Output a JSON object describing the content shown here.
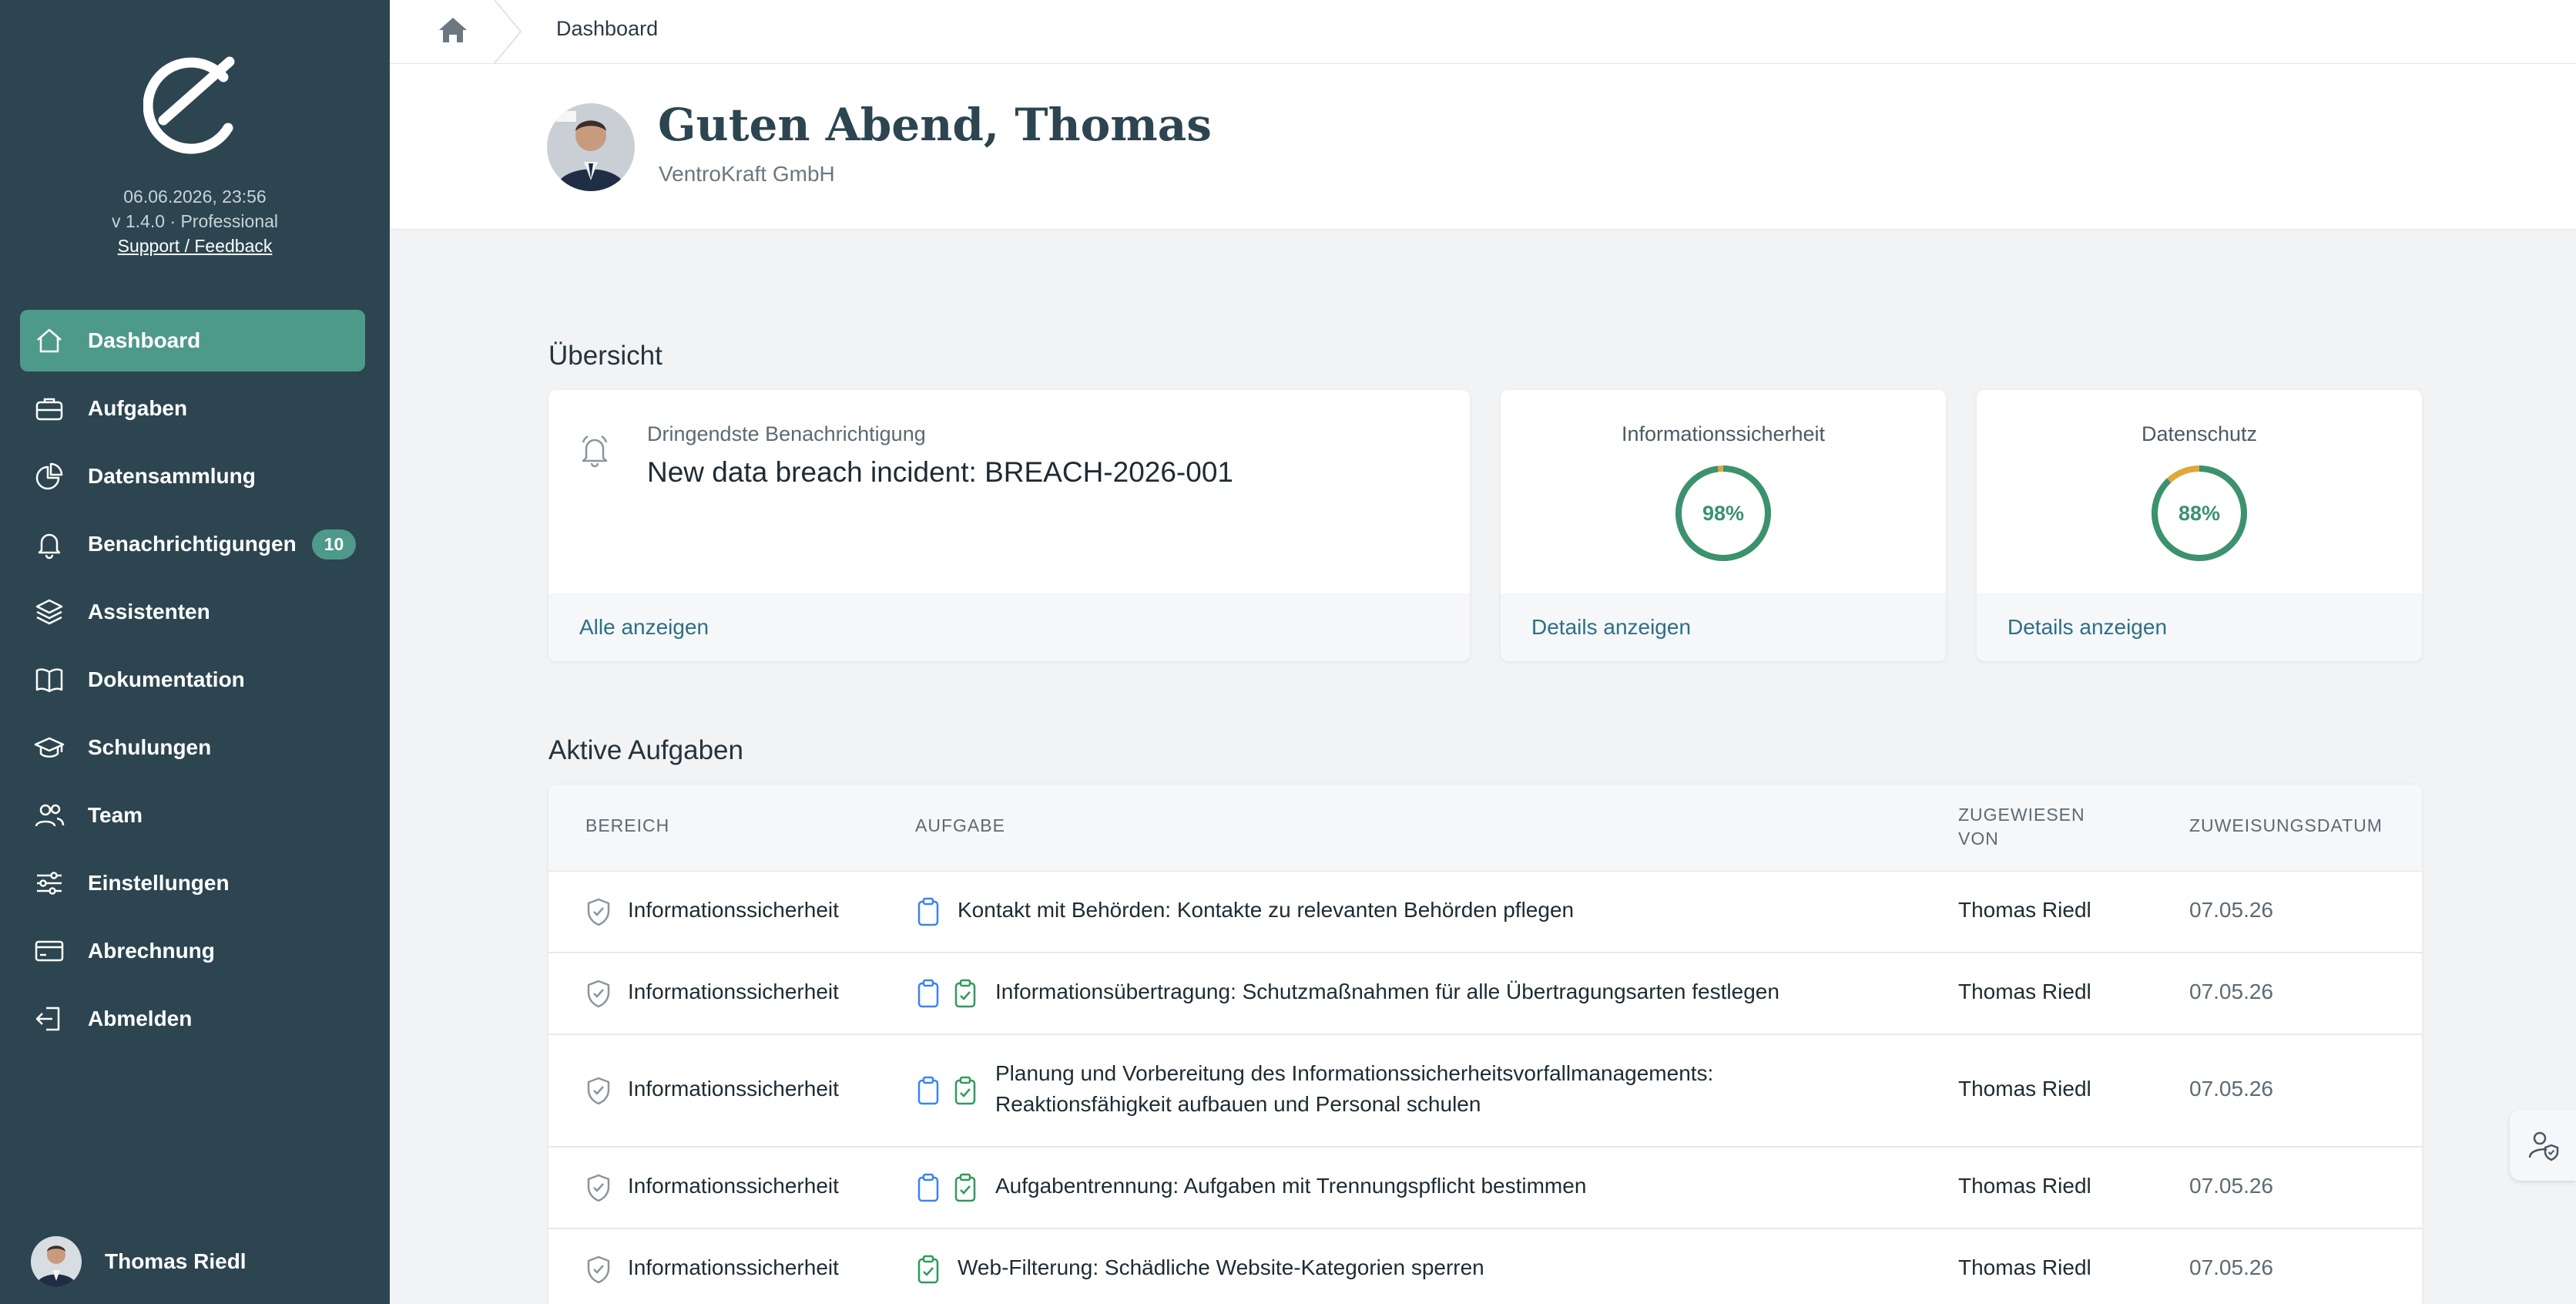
{
  "sidebar": {
    "datetime": "06.06.2026, 23:56",
    "version": "v 1.4.0 · Professional",
    "support_link": "Support / Feedback",
    "nav": [
      {
        "label": "Dashboard",
        "icon": "home-icon",
        "active": true
      },
      {
        "label": "Aufgaben",
        "icon": "briefcase-icon"
      },
      {
        "label": "Datensammlung",
        "icon": "pie-chart-icon"
      },
      {
        "label": "Benachrichtigungen",
        "icon": "bell-icon",
        "badge": "10"
      },
      {
        "label": "Assistenten",
        "icon": "layers-icon"
      },
      {
        "label": "Dokumentation",
        "icon": "book-icon"
      },
      {
        "label": "Schulungen",
        "icon": "graduation-cap-icon"
      },
      {
        "label": "Team",
        "icon": "users-icon"
      },
      {
        "label": "Einstellungen",
        "icon": "sliders-icon"
      },
      {
        "label": "Abrechnung",
        "icon": "credit-card-icon"
      },
      {
        "label": "Abmelden",
        "icon": "logout-icon"
      }
    ],
    "user_name": "Thomas Riedl"
  },
  "breadcrumb": {
    "current": "Dashboard"
  },
  "header": {
    "greeting": "Guten Abend, Thomas",
    "company": "VentroKraft GmbH"
  },
  "overview": {
    "title": "Übersicht",
    "notification": {
      "label": "Dringendste Benachrichtigung",
      "title": "New data breach incident: BREACH-2026-001",
      "link": "Alle anzeigen"
    },
    "info_security": {
      "label": "Informationssicherheit",
      "value_text": "98%",
      "value": 0.98,
      "link": "Details anzeigen"
    },
    "data_protection": {
      "label": "Datenschutz",
      "value_text": "88%",
      "value": 0.88,
      "link": "Details anzeigen"
    }
  },
  "tasks": {
    "title": "Aktive Aufgaben",
    "headers": {
      "area": "BEREICH",
      "task": "AUFGABE",
      "assigned_by": "ZUGEWIESEN VON",
      "date": "ZUWEISUNGSDATUM"
    },
    "rows": [
      {
        "area": "Informationssicherheit",
        "task": "Kontakt mit Behörden: Kontakte zu relevanten Behörden pflegen",
        "icons": [
          "clipboard-icon"
        ],
        "assigned_by": "Thomas Riedl",
        "date": "07.05.26"
      },
      {
        "area": "Informationssicherheit",
        "task": "Informationsübertragung: Schutzmaßnahmen für alle Übertragungsarten festlegen",
        "icons": [
          "clipboard-icon",
          "clipboard-check-icon"
        ],
        "assigned_by": "Thomas Riedl",
        "date": "07.05.26"
      },
      {
        "area": "Informationssicherheit",
        "task_line1": "Planung und Vorbereitung des Informationssicherheitsvorfallmanagements:",
        "task_line2": "Reaktionsfähigkeit aufbauen und Personal schulen",
        "icons": [
          "clipboard-icon",
          "clipboard-check-icon"
        ],
        "assigned_by": "Thomas Riedl",
        "date": "07.05.26"
      },
      {
        "area": "Informationssicherheit",
        "task": "Aufgabentrennung: Aufgaben mit Trennungspflicht bestimmen",
        "icons": [
          "clipboard-icon",
          "clipboard-check-icon"
        ],
        "assigned_by": "Thomas Riedl",
        "date": "07.05.26"
      },
      {
        "area": "Informationssicherheit",
        "task": "Web-Filterung: Schädliche Website-Kategorien sperren",
        "icons": [
          "clipboard-check-icon"
        ],
        "assigned_by": "Thomas Riedl",
        "date": "07.05.26"
      }
    ]
  },
  "colors": {
    "sidebar_bg": "#2c4550",
    "accent": "#4e9a8a",
    "link": "#2e6e86",
    "ring_green": "#3a9270",
    "ring_warning": "#e0a83a"
  }
}
